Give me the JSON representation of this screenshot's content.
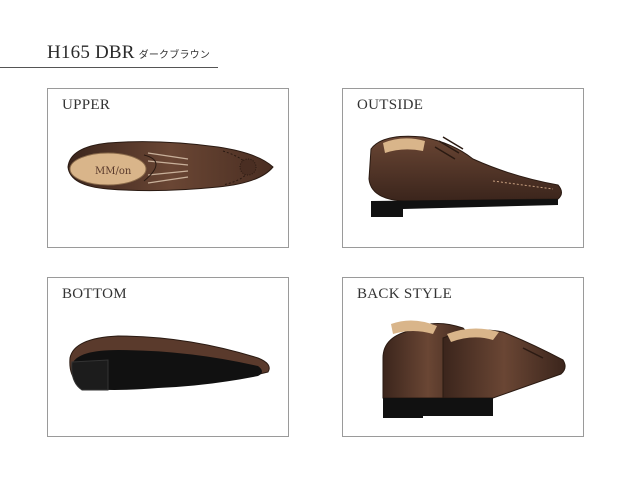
{
  "header": {
    "title": "H165 DBR",
    "subtitle": "ダークブラウン"
  },
  "panels": [
    {
      "label": "UPPER"
    },
    {
      "label": "OUTSIDE"
    },
    {
      "label": "BOTTOM"
    },
    {
      "label": "BACK STYLE"
    }
  ],
  "insole_logo": "MM/on",
  "colors": {
    "leather": "#5a3a2c",
    "leather_dark": "#3b251c",
    "insole": "#d9b58a",
    "sole": "#111111",
    "border": "#9a9a9a"
  }
}
